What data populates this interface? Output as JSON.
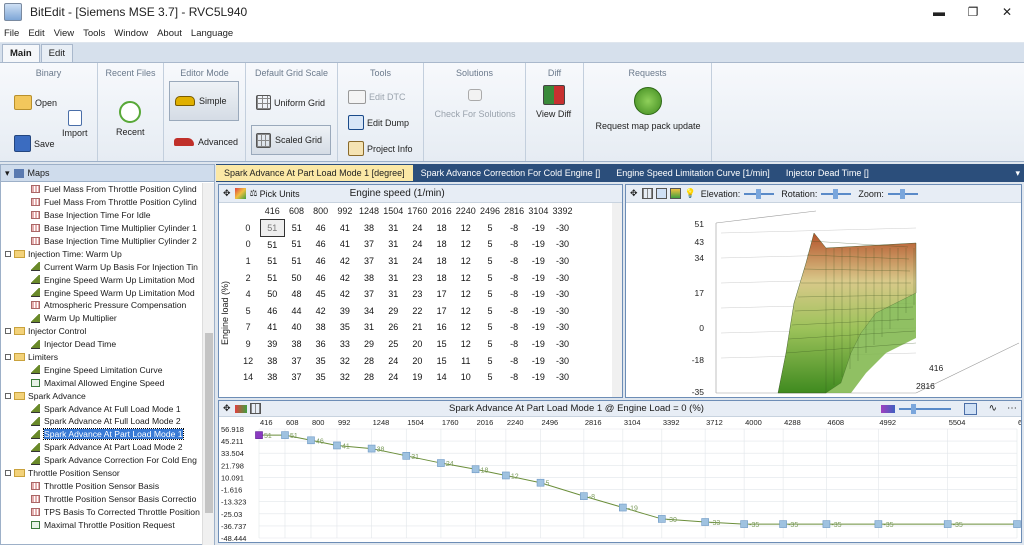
{
  "window": {
    "title": "BitEdit - [Siemens MSE 3.7] - RVC5L940",
    "min": "▬",
    "restore": "❐",
    "close": "✕"
  },
  "menu": [
    "File",
    "Edit",
    "View",
    "Tools",
    "Window",
    "About",
    "Language"
  ],
  "ribbon_tabs": [
    "Main",
    "Edit"
  ],
  "ribbon": {
    "binary": {
      "title": "Binary",
      "open": "Open",
      "import": "Import",
      "save": "Save"
    },
    "recent": {
      "title": "Recent Files",
      "recent": "Recent"
    },
    "editor_mode": {
      "title": "Editor Mode",
      "simple": "Simple",
      "advanced": "Advanced"
    },
    "grid_scale": {
      "title": "Default Grid Scale",
      "uniform": "Uniform Grid",
      "scaled": "Scaled Grid"
    },
    "tools": {
      "title": "Tools",
      "edit_dtc": "Edit DTC",
      "edit_dump": "Edit Dump",
      "project_info": "Project Info"
    },
    "solutions": {
      "title": "Solutions",
      "check": "Check For Solutions"
    },
    "diff": {
      "title": "Diff",
      "view": "View Diff"
    },
    "requests": {
      "title": "Requests",
      "update": "Request map pack update"
    }
  },
  "maps_panel": {
    "title": "Maps",
    "tree": [
      {
        "label": "Fuel Mass From Throttle Position Cylind",
        "icon": "map2d",
        "indent": 2
      },
      {
        "label": "Fuel Mass From Throttle Position Cylind",
        "icon": "map2d",
        "indent": 2
      },
      {
        "label": "Base Injection Time For Idle",
        "icon": "map2d",
        "indent": 2
      },
      {
        "label": "Base Injection Time Multiplier Cylinder 1",
        "icon": "map2d",
        "indent": 2
      },
      {
        "label": "Base Injection Time Multiplier Cylinder 2",
        "icon": "map2d",
        "indent": 2
      },
      {
        "label": "Injection Time: Warm Up",
        "icon": "folder",
        "indent": 1
      },
      {
        "label": "Current Warm Up Basis For Injection Tin",
        "icon": "map3d",
        "indent": 2
      },
      {
        "label": "Engine Speed Warm Up Limitation Mod",
        "icon": "map3d",
        "indent": 2
      },
      {
        "label": "Engine Speed Warm Up Limitation Mod",
        "icon": "map3d",
        "indent": 2
      },
      {
        "label": "Atmospheric Pressure Compensation",
        "icon": "map2d",
        "indent": 2
      },
      {
        "label": "Warm Up Multiplier",
        "icon": "map3d",
        "indent": 2
      },
      {
        "label": "Injector Control",
        "icon": "folder",
        "indent": 1
      },
      {
        "label": "Injector Dead Time",
        "icon": "map3d",
        "indent": 2
      },
      {
        "label": "Limiters",
        "icon": "folder",
        "indent": 1
      },
      {
        "label": "Engine Speed Limitation Curve",
        "icon": "map3d",
        "indent": 2
      },
      {
        "label": "Maximal Allowed Engine Speed",
        "icon": "map1d",
        "indent": 2
      },
      {
        "label": "Spark Advance",
        "icon": "folder",
        "indent": 1
      },
      {
        "label": "Spark Advance At Full Load Mode 1",
        "icon": "map3d",
        "indent": 2
      },
      {
        "label": "Spark Advance At Full Load Mode 2",
        "icon": "map3d",
        "indent": 2
      },
      {
        "label": "Spark Advance At Part Load Mode 1",
        "icon": "map3d",
        "indent": 2,
        "selected": true
      },
      {
        "label": "Spark Advance At Part Load Mode 2",
        "icon": "map3d",
        "indent": 2
      },
      {
        "label": "Spark Advance Correction For Cold Eng",
        "icon": "map3d",
        "indent": 2
      },
      {
        "label": "Throttle Position Sensor",
        "icon": "folder",
        "indent": 1
      },
      {
        "label": "Throttle Position Sensor Basis",
        "icon": "map2d",
        "indent": 2
      },
      {
        "label": "Throttle Position Sensor Basis Correctio",
        "icon": "map2d",
        "indent": 2
      },
      {
        "label": "TPS Basis To Corrected Throttle Position",
        "icon": "map2d",
        "indent": 2
      },
      {
        "label": "Maximal Throttle Position Request",
        "icon": "map1d",
        "indent": 2
      }
    ]
  },
  "doc_tabs": [
    "Spark Advance At Part Load Mode 1 [degree]",
    "Spark Advance Correction For Cold Engine []",
    "Engine Speed Limitation Curve [1/min]",
    "Injector Dead Time []"
  ],
  "table": {
    "pick_units": "Pick Units",
    "x_axis_label": "Engine speed (1/min)",
    "y_axis_label": "Engine load (%)",
    "columns": [
      "416",
      "608",
      "800",
      "992",
      "1248",
      "1504",
      "1760",
      "2016",
      "2240",
      "2496",
      "2816",
      "3104",
      "3392"
    ],
    "rows": [
      {
        "load": "0",
        "values": [
          "51",
          "51",
          "46",
          "41",
          "38",
          "31",
          "24",
          "18",
          "12",
          "5",
          "-8",
          "-19",
          "-30"
        ]
      },
      {
        "load": "0",
        "values": [
          "51",
          "51",
          "46",
          "41",
          "37",
          "31",
          "24",
          "18",
          "12",
          "5",
          "-8",
          "-19",
          "-30"
        ]
      },
      {
        "load": "1",
        "values": [
          "51",
          "51",
          "46",
          "42",
          "37",
          "31",
          "24",
          "18",
          "12",
          "5",
          "-8",
          "-19",
          "-30"
        ]
      },
      {
        "load": "2",
        "values": [
          "51",
          "50",
          "46",
          "42",
          "38",
          "31",
          "23",
          "18",
          "12",
          "5",
          "-8",
          "-19",
          "-30"
        ]
      },
      {
        "load": "4",
        "values": [
          "50",
          "48",
          "45",
          "42",
          "37",
          "31",
          "23",
          "17",
          "12",
          "5",
          "-8",
          "-19",
          "-30"
        ]
      },
      {
        "load": "5",
        "values": [
          "46",
          "44",
          "42",
          "39",
          "34",
          "29",
          "22",
          "17",
          "12",
          "5",
          "-8",
          "-19",
          "-30"
        ]
      },
      {
        "load": "7",
        "values": [
          "41",
          "40",
          "38",
          "35",
          "31",
          "26",
          "21",
          "16",
          "12",
          "5",
          "-8",
          "-19",
          "-30"
        ]
      },
      {
        "load": "9",
        "values": [
          "39",
          "38",
          "36",
          "33",
          "29",
          "25",
          "20",
          "15",
          "12",
          "5",
          "-8",
          "-19",
          "-30"
        ]
      },
      {
        "load": "12",
        "values": [
          "38",
          "37",
          "35",
          "32",
          "28",
          "24",
          "20",
          "15",
          "11",
          "5",
          "-8",
          "-19",
          "-30"
        ]
      },
      {
        "load": "14",
        "values": [
          "38",
          "37",
          "35",
          "32",
          "28",
          "24",
          "19",
          "14",
          "10",
          "5",
          "-8",
          "-19",
          "-30"
        ]
      }
    ]
  },
  "view3d": {
    "elevation_label": "Elevation:",
    "rotation_label": "Rotation:",
    "zoom_label": "Zoom:",
    "z_ticks": [
      "51",
      "43",
      "34",
      "17",
      "0",
      "-18",
      "-35"
    ],
    "x_ticks": [
      "416",
      "2816"
    ]
  },
  "graph": {
    "title": "Spark Advance At Part Load Mode 1 @ Engine Load = 0 (%)",
    "x_ticks": [
      "416",
      "608",
      "800",
      "992",
      "1248",
      "1504",
      "1760",
      "2016",
      "2240",
      "2496",
      "2816",
      "3104",
      "3392",
      "3712",
      "4000",
      "4288",
      "4608",
      "4992",
      "5504",
      "6016"
    ],
    "y_ticks": [
      "56.918",
      "45.211",
      "33.504",
      "21.798",
      "10.091",
      "-1.616",
      "-13.323",
      "-25.03",
      "-36.737",
      "-48.444"
    ]
  },
  "chart_data": {
    "type": "line",
    "title": "Spark Advance At Part Load Mode 1 @ Engine Load = 0 (%)",
    "x": [
      416,
      608,
      800,
      992,
      1248,
      1504,
      1760,
      2016,
      2240,
      2496,
      2816,
      3104,
      3392,
      3712,
      4000,
      4288,
      4608,
      4992,
      5504,
      6016
    ],
    "series": [
      {
        "values": [
          51,
          51,
          46,
          41,
          38,
          31,
          24,
          18,
          12,
          5,
          -8,
          -19,
          -30,
          -33,
          -35,
          -35,
          -35,
          -35,
          -35,
          -35
        ]
      }
    ],
    "ylim": [
      -48.444,
      56.918
    ],
    "grid": true
  }
}
